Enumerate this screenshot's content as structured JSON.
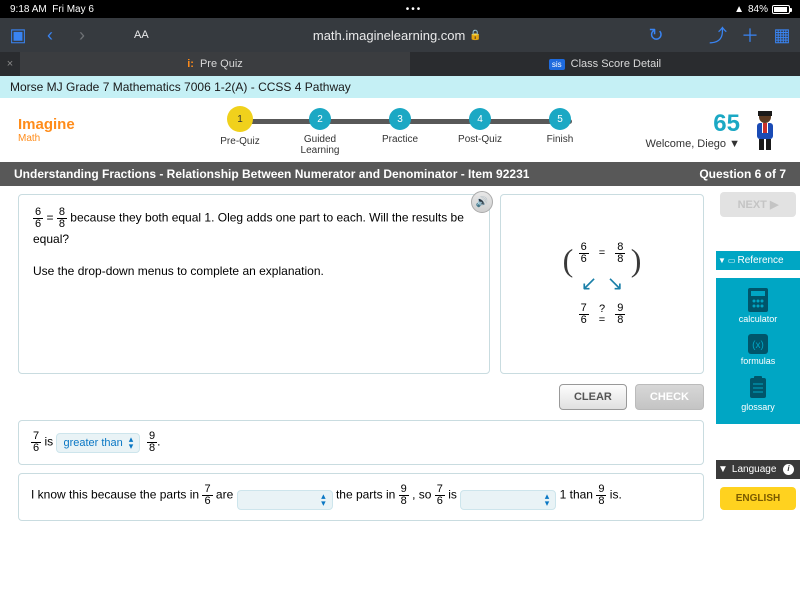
{
  "status": {
    "time": "9:18 AM",
    "date": "Fri May 6",
    "battery": "84%",
    "dots": "•••"
  },
  "browser": {
    "url": "math.imaginelearning.com",
    "aa": "AA"
  },
  "tabs": {
    "t1": "Pre Quiz",
    "t2": "Class Score Detail",
    "sis": "sis"
  },
  "course": "Morse MJ Grade 7 Mathematics 7006 1-2(A) - CCSS 4 Pathway",
  "logo": {
    "main": "Imagine",
    "sub": "Math"
  },
  "steps": [
    {
      "n": "1",
      "label": "Pre-Quiz"
    },
    {
      "n": "2",
      "label": "Guided\nLearning"
    },
    {
      "n": "3",
      "label": "Practice"
    },
    {
      "n": "4",
      "label": "Post-Quiz"
    },
    {
      "n": "5",
      "label": "Finish"
    }
  ],
  "score": "65",
  "welcome": "Welcome, Diego",
  "itembar": {
    "title": "Understanding Fractions - Relationship Between Numerator and Denominator - Item 92231",
    "progress": "Question 6 of 7"
  },
  "question": {
    "p1a": " because they both equal 1. Oleg adds one part to each. Will the results be equal?",
    "p2": "Use the drop-down menus to complete an explanation."
  },
  "answer1": {
    "is": " is ",
    "sel": "greater than",
    "period": "."
  },
  "answer2": {
    "t1": "I know this because the parts in ",
    "t2": " are ",
    "t3": " the parts in ",
    "t4": ", so ",
    "t5": " is ",
    "t6": " 1 than ",
    "t7": " is."
  },
  "buttons": {
    "clear": "CLEAR",
    "check": "CHECK",
    "next": "NEXT ▶"
  },
  "side": {
    "ref": "Reference",
    "calc": "calculator",
    "form": "formulas",
    "gloss": "glossary",
    "lang": "Language",
    "eng": "ENGLISH"
  },
  "frac": {
    "six6n": "6",
    "six6d": "6",
    "eight8n": "8",
    "eight8d": "8",
    "seven6n": "7",
    "seven6d": "6",
    "nine8n": "9",
    "nine8d": "8"
  },
  "eq": "=",
  "qmark": "?"
}
